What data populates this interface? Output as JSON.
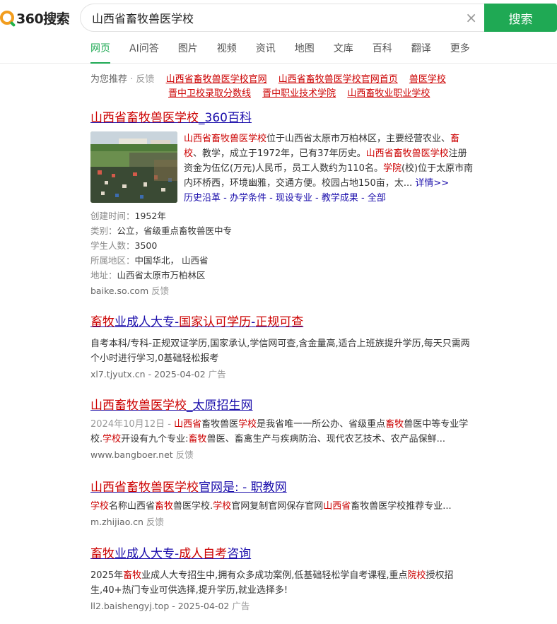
{
  "header": {
    "logo_text": "360搜索",
    "query": "山西省畜牧兽医学校",
    "clear": "×",
    "search_button": "搜索",
    "tabs": [
      "网页",
      "AI问答",
      "图片",
      "视频",
      "资讯",
      "地图",
      "文库",
      "百科",
      "翻译",
      "更多"
    ]
  },
  "recommend": {
    "prefix": "为您推荐",
    "feedback": "· 反馈",
    "links": [
      "山西省畜牧兽医学校官网",
      "山西省畜牧兽医学校官网首页",
      "兽医学校",
      "晋中卫校录取分数线",
      "晋中职业技术学院",
      "山西畜牧业职业学校"
    ]
  },
  "results": [
    {
      "title_hl": "山西省畜牧兽医学校",
      "title_rest": "_360百科",
      "desc": {
        "p1": "山西省畜牧兽医学校",
        "p2": "位于山西省太原市万柏林区，主要经营农业、",
        "p3": "畜校",
        "p4": "、教学，成立于1972年，已有37年历史。",
        "p5": "山西省畜牧兽医学校",
        "p6": "注册资金为伍亿(万元)人民币，员工人数约为110名。",
        "p7": "学院",
        "p8": "(校)位于太原市南内环桥西，环境幽雅，交通方便。校园占地150亩，太...",
        "more": "详情>>"
      },
      "sublinks": "历史沿革 - 办学条件 - 现设专业 - 教学成果 - 全部",
      "info": [
        {
          "k": "创建时间：",
          "v": "1952年"
        },
        {
          "k": "类别：",
          "v": "公立，省级重点畜牧兽医中专"
        },
        {
          "k": "学生人数：",
          "v": "3500"
        },
        {
          "k": "所属地区：",
          "v": "中国华北， 山西省"
        },
        {
          "k": "地址：",
          "v": "山西省太原市万柏林区"
        }
      ],
      "url": "baike.so.com",
      "feedback": "反馈"
    },
    {
      "title_parts": [
        "畜牧",
        "业成人大专-",
        "国家认可学历",
        "-",
        "正规可查"
      ],
      "desc": "自考本科/专科-正规双证学历,国家承认,学信网可查,含金量高,适合上班族提升学历,每天只需两个小时进行学习,0基础轻松报考",
      "url": "xl7.tjyutx.cn - 2025-04-02",
      "ad": "广告"
    },
    {
      "title_hl": "山西畜牧兽医学校",
      "title_rest": "_太原招生网",
      "date": "2024年10月12日 - ",
      "desc_parts": [
        "山西省",
        "畜牧兽医",
        "学校",
        "是我省唯一一所公办、省级重点",
        "畜牧",
        "兽医中等专业学校.",
        "学校",
        "开设有九个专业:",
        "畜牧",
        "兽医、畜禽生产与疾病防治、现代农艺技术、农产品保鲜..."
      ],
      "url": "www.bangboer.net",
      "feedback": "反馈"
    },
    {
      "title_hl": "山西省畜牧兽医学校",
      "title_rest": "官网是: - 职教网",
      "desc_parts": [
        "学校",
        "名称山西省",
        "畜牧",
        "兽医学校.",
        "学校",
        "官网复制官网保存官网",
        "山西省",
        "畜牧兽医学校推荐专业..."
      ],
      "url": "m.zhijiao.cn",
      "feedback": "反馈"
    },
    {
      "title_parts": [
        "畜牧",
        "业成人大专-",
        "成人",
        "自考",
        "咨询"
      ],
      "desc_parts": [
        "2025年",
        "畜牧",
        "业成人大专招生中,拥有众多成功案例,低基础轻松学自考课程,重点",
        "院校",
        "授权招生,40+热门专业可供选择,提升学历,就业选择多!"
      ],
      "url": "ll2.baishengyj.top - 2025-04-02",
      "ad": "广告"
    }
  ]
}
